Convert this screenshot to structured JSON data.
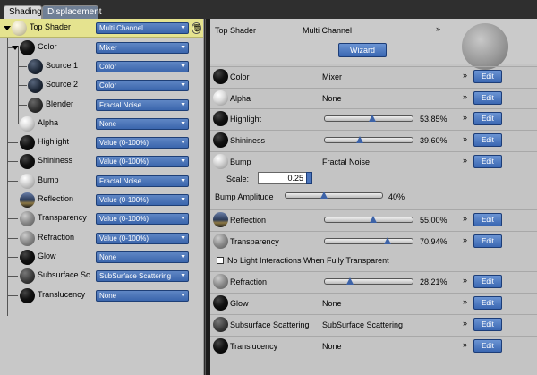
{
  "tabs": [
    {
      "label": "Shading",
      "active": true
    },
    {
      "label": "Displacement",
      "active": false
    }
  ],
  "tree": [
    {
      "name": "Top Shader",
      "value": "Multi Channel"
    },
    {
      "name": "Color",
      "value": "Mixer"
    },
    {
      "name": "Source 1",
      "value": "Color"
    },
    {
      "name": "Source 2",
      "value": "Color"
    },
    {
      "name": "Blender",
      "value": "Fractal Noise"
    },
    {
      "name": "Alpha",
      "value": "None"
    },
    {
      "name": "Highlight",
      "value": "Value (0-100%)"
    },
    {
      "name": "Shininess",
      "value": "Value (0-100%)"
    },
    {
      "name": "Bump",
      "value": "Fractal Noise"
    },
    {
      "name": "Reflection",
      "value": "Value (0-100%)"
    },
    {
      "name": "Transparency",
      "value": "Value (0-100%)"
    },
    {
      "name": "Refraction",
      "value": "Value (0-100%)"
    },
    {
      "name": "Glow",
      "value": "None"
    },
    {
      "name": "Subsurface Sc",
      "value": "SubSurface Scattering"
    },
    {
      "name": "Translucency",
      "value": "None"
    }
  ],
  "header": {
    "title": "Top Shader",
    "type": "Multi Channel",
    "wizard_label": "Wizard"
  },
  "props": [
    {
      "name": "Color",
      "value": "Mixer"
    },
    {
      "name": "Alpha",
      "value": "None"
    },
    {
      "name": "Highlight",
      "slider": 0.5385,
      "pct": "53.85%"
    },
    {
      "name": "Shininess",
      "slider": 0.396,
      "pct": "39.60%"
    },
    {
      "name": "Bump",
      "value": "Fractal Noise"
    },
    {
      "name": "Reflection",
      "slider": 0.55,
      "pct": "55.00%"
    },
    {
      "name": "Transparency",
      "slider": 0.7094,
      "pct": "70.94%"
    },
    {
      "name": "Refraction",
      "slider": 0.2821,
      "pct": "28.21%"
    },
    {
      "name": "Glow",
      "value": "None"
    },
    {
      "name": "Subsurface Scattering",
      "value": "SubSurface Scattering"
    },
    {
      "name": "Translucency",
      "value": "None"
    }
  ],
  "bump_extra": {
    "scale_label": "Scale:",
    "scale_value": "0.25",
    "amplitude_label": "Bump Amplitude",
    "amplitude_slider": 0.4,
    "amplitude_pct": "40%"
  },
  "no_light_label": "No Light Interactions When Fully Transparent",
  "edit_label": "Edit",
  "chevron": "»"
}
